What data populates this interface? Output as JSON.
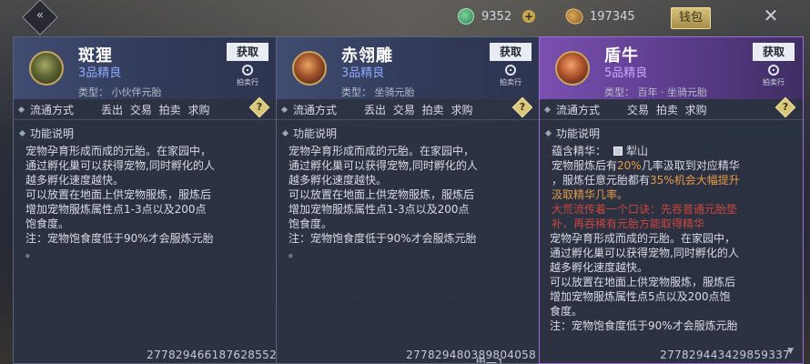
{
  "topbar": {
    "jade_amount": "9352",
    "plus_label": "+",
    "stone_amount": "197345",
    "shop_label": "钱包",
    "back_icon": "chevron-left-icon",
    "close_icon": "close-icon"
  },
  "cards": [
    {
      "name": "斑狸",
      "grade": "3品精良",
      "type_line": "类型：  小伙伴元胎",
      "get_label": "获取",
      "auction_label": "拍卖行",
      "circulation_label": "流通方式",
      "circulation_opts": "丢出 交易 拍卖 求购",
      "func_title": "功能说明",
      "desc": "宠物孕育形成而成的元胎。在家园中，\n通过孵化巢可以获得宠物,同时孵化的人\n越多孵化速度越快。\n可以放置在地面上供宠物服炼，服炼后\n增加宠物服炼属性点1-3点以及200点\n饱食度。\n注：宠物饱食度低于90%才会服炼元胎\n。",
      "code": "277829466187628552"
    },
    {
      "name": "赤翎雕",
      "grade": "3品精良",
      "type_line": "类型：  坐骑元胎",
      "get_label": "获取",
      "auction_label": "拍卖行",
      "circulation_label": "流通方式",
      "circulation_opts": "丢出 交易 拍卖 求购",
      "func_title": "功能说明",
      "desc": "宠物孕育形成而成的元胎。在家园中，\n通过孵化巢可以获得宠物,同时孵化的人\n越多孵化速度越快。\n可以放置在地面上供宠物服炼，服炼后\n增加宠物服炼属性点1-3点以及200点\n饱食度。\n注：宠物饱食度低于90%才会服炼元胎\n。",
      "code": "277829480389804058",
      "stack": "用一1"
    },
    {
      "name": "盾牛",
      "grade": "5品精良",
      "type_line": "类型：  百年 · 坐骑元胎",
      "get_label": "获取",
      "auction_label": "拍卖行",
      "circulation_label": "流通方式",
      "circulation_opts": "交易 拍卖 求购",
      "func_title": "功能说明",
      "essence_label": "蕴含精华：",
      "essence_name": "犁山",
      "ess1_a": "宠物服炼后有",
      "ess1_pct": "20%",
      "ess1_b": "几率汲取到对应精华",
      "ess2_a": "，服炼任意元胎都有",
      "ess2_pct": "35%机会大幅提升",
      "ess3": "汲取精华几率。",
      "red1": "大荒流传着一个口诀：先吞普通元胎垫",
      "red2": "补，再吞稀有元胎方能取得精华",
      "desc": "宠物孕育形成而成的元胎。在家园中，\n通过孵化巢可以获得宠物,同时孵化的人\n越多孵化速度越快。\n可以放置在地面上供宠物服炼，服炼后\n增加宠物服炼属性点5点以及200点饱\n食度。\n注：宠物饱食度低于90%才会服炼元胎",
      "code": "277829443429859337"
    }
  ]
}
